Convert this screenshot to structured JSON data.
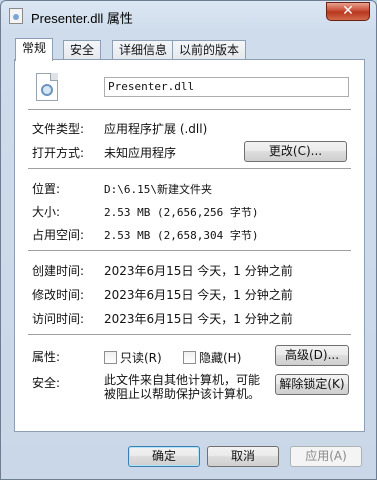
{
  "window": {
    "title": "Presenter.dll 属性",
    "close": "✕"
  },
  "tabs": [
    "常规",
    "安全",
    "详细信息",
    "以前的版本"
  ],
  "general": {
    "filename": "Presenter.dll",
    "type_label": "文件类型:",
    "type_value": "应用程序扩展 (.dll)",
    "opens_label": "打开方式:",
    "opens_value": "未知应用程序",
    "change_button": "更改(C)...",
    "location_label": "位置:",
    "location_value": "D:\\6.15\\新建文件夹",
    "size_label": "大小:",
    "size_value": "2.53 MB (2,656,256 字节)",
    "disk_label": "占用空间:",
    "disk_value": "2.53 MB (2,658,304 字节)",
    "created_label": "创建时间:",
    "created_value": "2023年6月15日 今天，1 分钟之前",
    "modified_label": "修改时间:",
    "modified_value": "2023年6月15日 今天，1 分钟之前",
    "accessed_label": "访问时间:",
    "accessed_value": "2023年6月15日 今天，1 分钟之前",
    "attributes_label": "属性:",
    "readonly_label": "只读(R)",
    "hidden_label": "隐藏(H)",
    "advanced_button": "高级(D)...",
    "security_label": "安全:",
    "security_text": "此文件来自其他计算机，可能被阻止以帮助保护该计算机。",
    "unblock_button": "解除锁定(K)"
  },
  "footer": {
    "ok": "确定",
    "cancel": "取消",
    "apply": "应用(A)"
  },
  "icons": {
    "file": "dll-file-icon",
    "title": "dll-file-icon"
  }
}
